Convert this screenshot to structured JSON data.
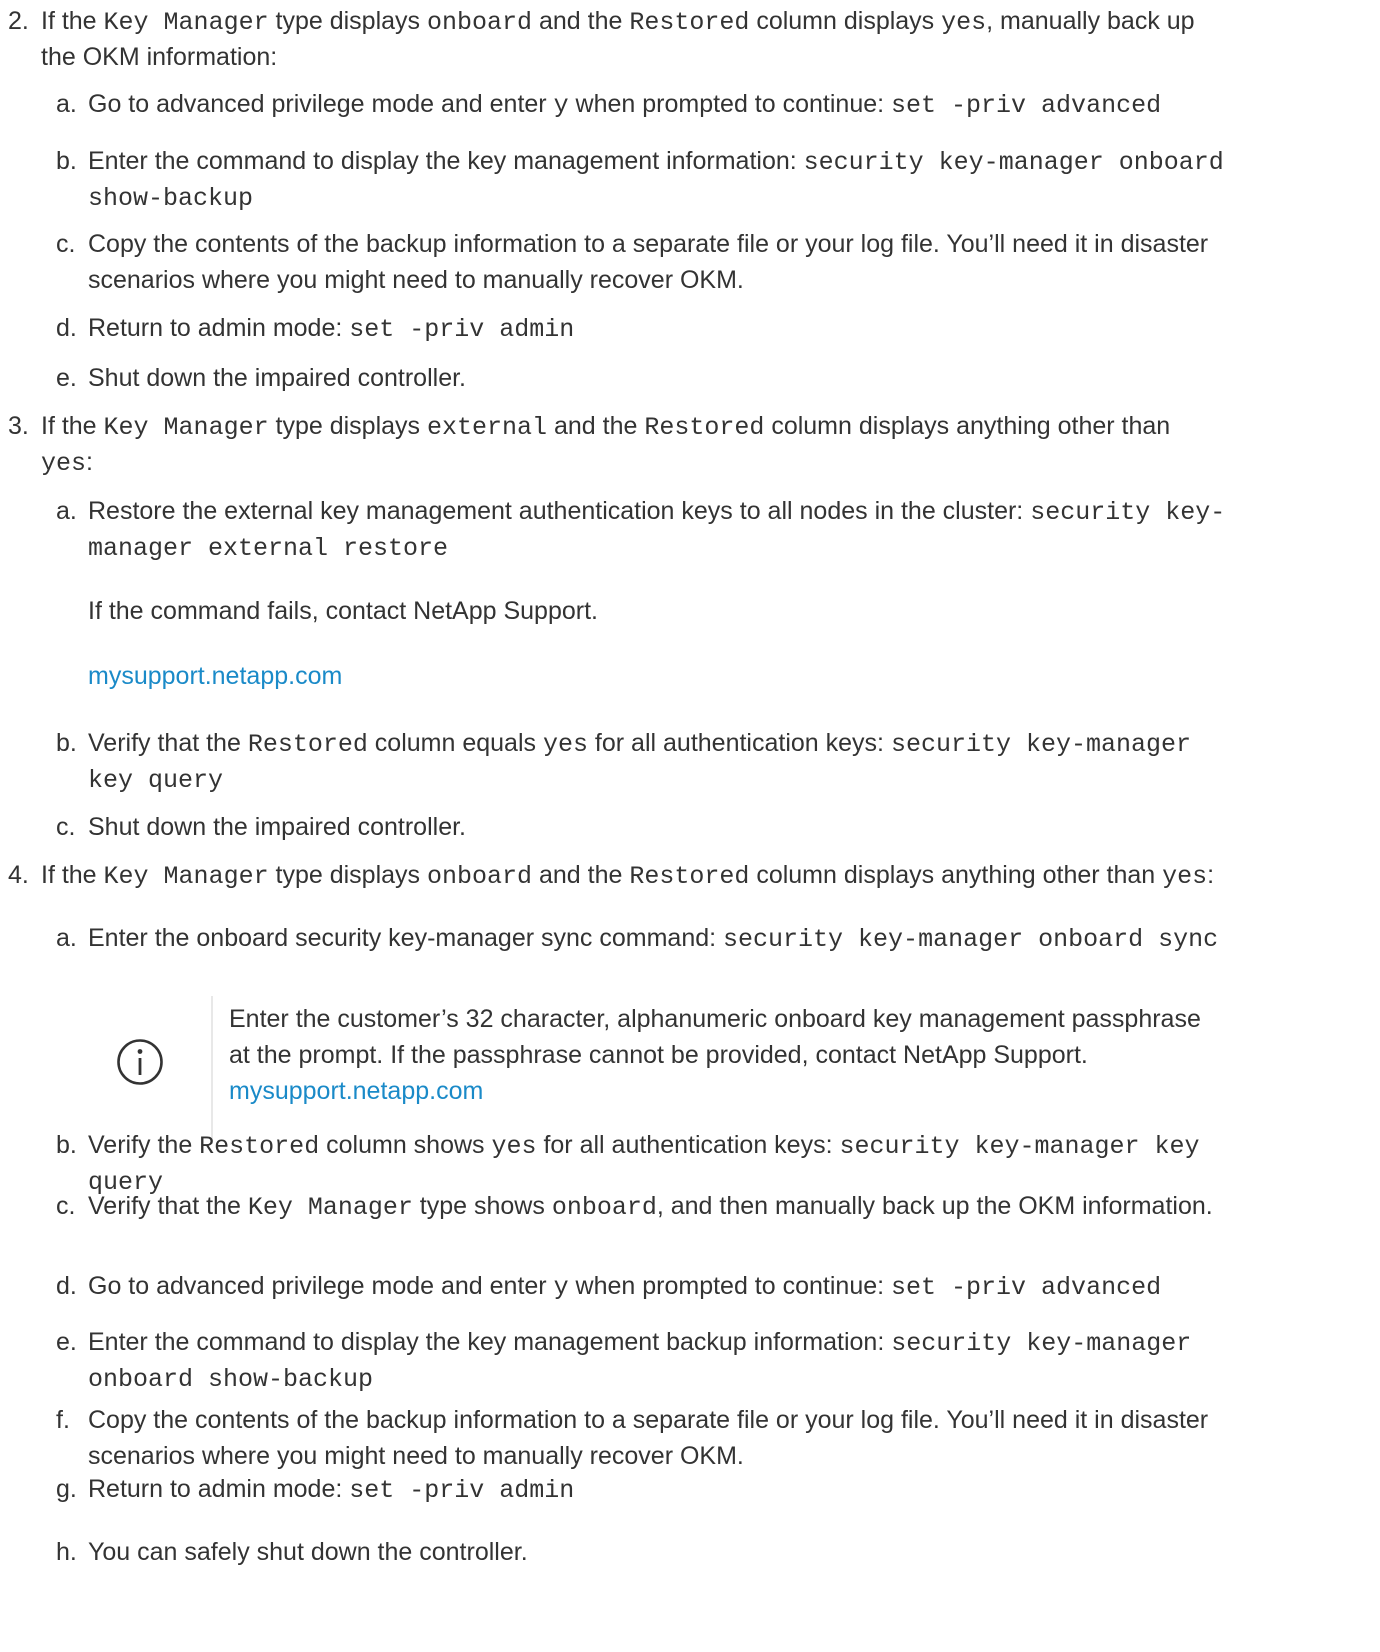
{
  "steps": [
    {
      "marker": "2.",
      "lines": [
        [
          [
            "t",
            "If the "
          ],
          [
            "c",
            "Key Manager"
          ],
          [
            "t",
            " type displays "
          ],
          [
            "c",
            "onboard"
          ],
          [
            "t",
            " and the "
          ],
          [
            "c",
            "Restored"
          ],
          [
            "t",
            " column displays "
          ],
          [
            "c",
            "yes"
          ],
          [
            "t",
            ", manually back up"
          ]
        ],
        [
          [
            "t",
            "the OKM information:"
          ]
        ]
      ],
      "substeps": [
        {
          "marker": "a.",
          "lines": [
            [
              [
                "t",
                "Go to advanced privilege mode and enter "
              ],
              [
                "c",
                "y"
              ],
              [
                "t",
                " when prompted to continue: "
              ],
              [
                "c",
                "set -priv advanced"
              ]
            ]
          ]
        },
        {
          "marker": "b.",
          "lines": [
            [
              [
                "t",
                "Enter the command to display the key management information: "
              ],
              [
                "c",
                "security key-manager onboard"
              ]
            ],
            [
              [
                "c",
                "show-backup"
              ]
            ]
          ]
        },
        {
          "marker": "c.",
          "lines": [
            [
              [
                "t",
                "Copy the contents of the backup information to a separate file or your log file. You’ll need it in disaster"
              ]
            ],
            [
              [
                "t",
                "scenarios where you might need to manually recover OKM."
              ]
            ]
          ]
        },
        {
          "marker": "d.",
          "lines": [
            [
              [
                "t",
                "Return to admin mode: "
              ],
              [
                "c",
                "set -priv admin"
              ]
            ]
          ]
        },
        {
          "marker": "e.",
          "lines": [
            [
              [
                "t",
                "Shut down the impaired controller."
              ]
            ]
          ]
        }
      ]
    },
    {
      "marker": "3.",
      "lines": [
        [
          [
            "t",
            "If the "
          ],
          [
            "c",
            "Key Manager"
          ],
          [
            "t",
            " type displays "
          ],
          [
            "c",
            "external"
          ],
          [
            "t",
            " and the "
          ],
          [
            "c",
            "Restored"
          ],
          [
            "t",
            " column displays anything other than"
          ]
        ],
        [
          [
            "c",
            "yes"
          ],
          [
            "t",
            ":"
          ]
        ]
      ],
      "substeps": [
        {
          "marker": "a.",
          "lines": [
            [
              [
                "t",
                "Restore the external key management authentication keys to all nodes in the cluster: "
              ],
              [
                "c",
                "security key-"
              ]
            ],
            [
              [
                "c",
                "manager external restore"
              ]
            ]
          ]
        },
        {
          "marker": "",
          "lines": [
            [
              [
                "t",
                "If the command fails, contact NetApp Support."
              ]
            ]
          ]
        },
        {
          "marker": "",
          "lines": [
            [
              [
                "l",
                "mysupport.netapp.com"
              ]
            ]
          ]
        },
        {
          "marker": "b.",
          "lines": [
            [
              [
                "t",
                "Verify that the "
              ],
              [
                "c",
                "Restored"
              ],
              [
                "t",
                " column equals "
              ],
              [
                "c",
                "yes"
              ],
              [
                "t",
                " for all authentication keys: "
              ],
              [
                "c",
                "security key-manager"
              ]
            ],
            [
              [
                "c",
                "key query"
              ]
            ]
          ]
        },
        {
          "marker": "c.",
          "lines": [
            [
              [
                "t",
                "Shut down the impaired controller."
              ]
            ]
          ]
        }
      ]
    },
    {
      "marker": "4.",
      "lines": [
        [
          [
            "t",
            "If the "
          ],
          [
            "c",
            "Key Manager"
          ],
          [
            "t",
            " type displays "
          ],
          [
            "c",
            "onboard"
          ],
          [
            "t",
            " and the "
          ],
          [
            "c",
            "Restored"
          ],
          [
            "t",
            " column displays anything other than "
          ],
          [
            "c",
            "yes"
          ],
          [
            "t",
            ":"
          ]
        ]
      ],
      "substeps": [
        {
          "marker": "a.",
          "lines": [
            [
              [
                "t",
                "Enter the onboard security key-manager sync command: "
              ],
              [
                "c",
                "security key-manager onboard sync"
              ]
            ]
          ]
        },
        {
          "marker": "b.",
          "lines": [
            [
              [
                "t",
                "Verify the "
              ],
              [
                "c",
                "Restored"
              ],
              [
                "t",
                " column shows "
              ],
              [
                "c",
                "yes"
              ],
              [
                "t",
                " for all authentication keys: "
              ],
              [
                "c",
                "security key-manager key"
              ]
            ],
            [
              [
                "c",
                "query"
              ]
            ]
          ]
        },
        {
          "marker": "c.",
          "lines": [
            [
              [
                "t",
                "Verify that the "
              ],
              [
                "c",
                "Key Manager"
              ],
              [
                "t",
                " type shows "
              ],
              [
                "c",
                "onboard"
              ],
              [
                "t",
                ", and then manually back up the OKM information."
              ]
            ]
          ]
        },
        {
          "marker": "d.",
          "lines": [
            [
              [
                "t",
                "Go to advanced privilege mode and enter "
              ],
              [
                "c",
                "y"
              ],
              [
                "t",
                " when prompted to continue: "
              ],
              [
                "c",
                "set -priv advanced"
              ]
            ]
          ]
        },
        {
          "marker": "e.",
          "lines": [
            [
              [
                "t",
                "Enter the command to display the key management backup information: "
              ],
              [
                "c",
                "security key-manager"
              ]
            ],
            [
              [
                "c",
                "onboard show-backup"
              ]
            ]
          ]
        },
        {
          "marker": "f.",
          "lines": [
            [
              [
                "t",
                "Copy the contents of the backup information to a separate file or your log file. You’ll need it in disaster"
              ]
            ],
            [
              [
                "t",
                "scenarios where you might need to manually recover OKM."
              ]
            ]
          ]
        },
        {
          "marker": "g.",
          "lines": [
            [
              [
                "t",
                "Return to admin mode: "
              ],
              [
                "c",
                "set -priv admin"
              ]
            ]
          ]
        },
        {
          "marker": "h.",
          "lines": [
            [
              [
                "t",
                "You can safely shut down the controller."
              ]
            ]
          ]
        }
      ]
    }
  ],
  "note": {
    "icon": "info-icon",
    "lines": [
      [
        [
          "t",
          "Enter the customer’s 32 character, alphanumeric onboard key management passphrase"
        ]
      ],
      [
        [
          "t",
          "at the prompt. If the passphrase cannot be provided, contact NetApp Support."
        ]
      ],
      [
        [
          "l",
          "mysupport.netapp.com"
        ]
      ]
    ]
  },
  "colors": {
    "text": "#333333",
    "link": "#1a8ac8",
    "rule": "#e8e8e8"
  }
}
